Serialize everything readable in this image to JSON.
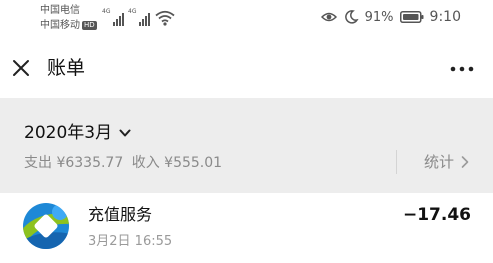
{
  "status_bar": {
    "carrier_1": "中国电信",
    "carrier_2": "中国移动",
    "hd_badge": "HD",
    "network_1": "4G",
    "network_2": "4G",
    "battery_percent": "91%",
    "time": "9:10",
    "icons": [
      "signal-icon",
      "wifi-icon",
      "eye-icon",
      "moon-icon",
      "battery-icon"
    ]
  },
  "header": {
    "title": "账单",
    "close_icon": "close-icon",
    "more_icon": "more-icon"
  },
  "summary": {
    "month": "2020年3月",
    "expense": "支出 ¥6335.77",
    "income": "收入 ¥555.01",
    "stats_label": "统计"
  },
  "transactions": [
    {
      "name": "充值服务",
      "time": "3月2日 16:55",
      "amount": "−17.46",
      "icon": "service-logo-icon"
    }
  ],
  "colors": {
    "background": "#ffffff",
    "summary_background": "#ededed",
    "secondary_text": "#8a8a8a",
    "logo_blue": "#1e88d6",
    "logo_green": "#8dc21f"
  }
}
